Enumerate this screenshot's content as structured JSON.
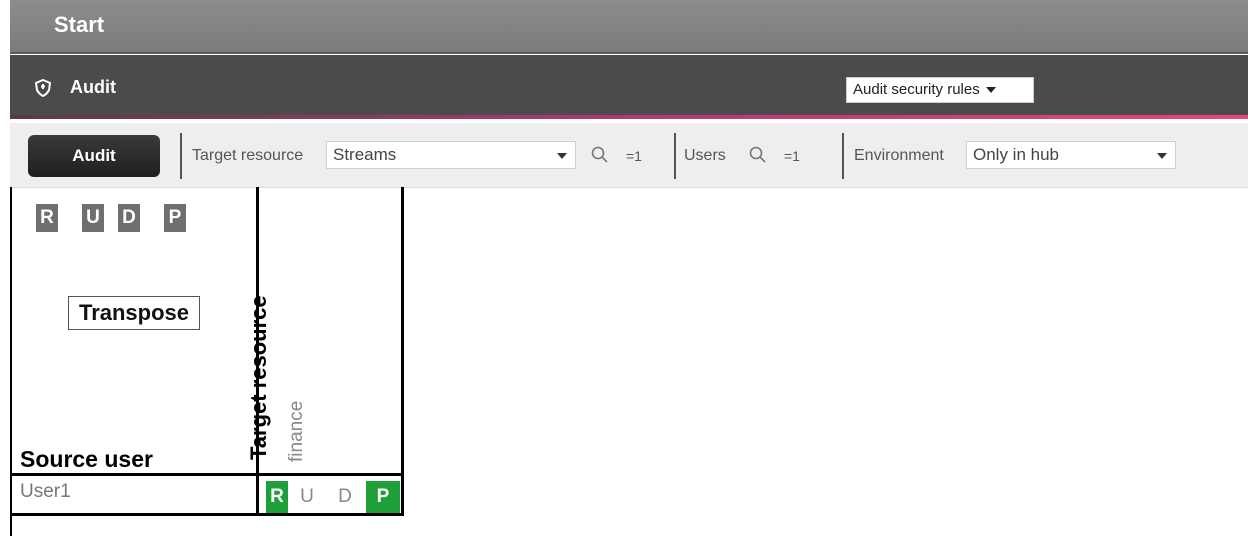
{
  "app": {
    "title": "Start"
  },
  "header": {
    "title": "Audit",
    "icon": "shield-icon",
    "rules_dropdown": "Audit security rules"
  },
  "toolbar": {
    "audit_button": "Audit",
    "target_resource_label": "Target resource",
    "target_resource_value": "Streams",
    "target_count": "=1",
    "users_label": "Users",
    "users_count": "=1",
    "environment_label": "Environment",
    "environment_value": "Only in hub"
  },
  "matrix": {
    "toggles": [
      "R",
      "U",
      "D",
      "P"
    ],
    "transpose_label": "Transpose",
    "row_axis_label": "Source user",
    "column_axis_label": "Target resource",
    "columns": [
      "finance"
    ],
    "rows": [
      {
        "user": "User1",
        "permissions": [
          {
            "letter": "R",
            "granted": true
          },
          {
            "letter": "U",
            "granted": false
          },
          {
            "letter": "D",
            "granted": false
          },
          {
            "letter": "P",
            "granted": true
          }
        ]
      }
    ]
  },
  "colors": {
    "granted": "#1f9f3a",
    "accent_pink": "#e3487f",
    "header_dark": "#4b4b4b"
  }
}
